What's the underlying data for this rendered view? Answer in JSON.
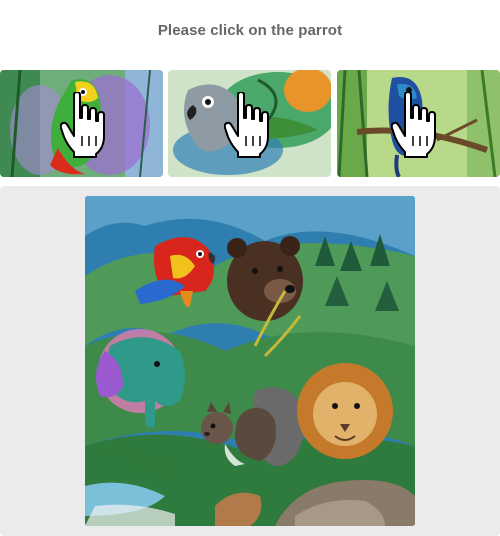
{
  "prompt": {
    "text": "Please click on the parrot"
  },
  "examples": [
    {
      "name": "example-parrot-1",
      "description": "green-yellow parrot"
    },
    {
      "name": "example-parrot-2",
      "description": "grey parrot in leaves"
    },
    {
      "name": "example-parrot-3",
      "description": "blue parrot on branch"
    }
  ],
  "challenge": {
    "animals": [
      "parrot",
      "bear",
      "elephant",
      "squirrel",
      "lion"
    ]
  },
  "colors": {
    "prompt_text": "#666666",
    "panel_bg": "#ebebeb"
  }
}
